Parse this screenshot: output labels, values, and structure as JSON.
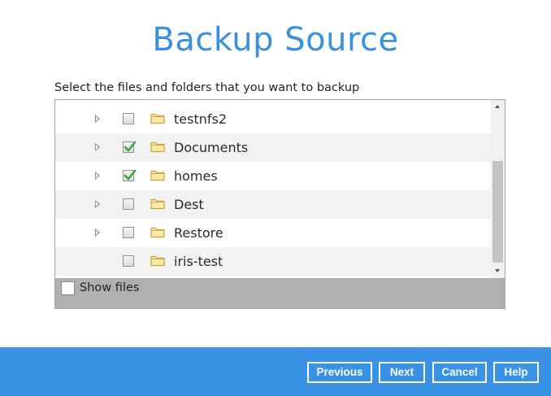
{
  "page": {
    "title": "Backup Source",
    "instruction": "Select the files and folders that you want to backup"
  },
  "tree": {
    "items": [
      {
        "label": "testnfs2",
        "checked": false,
        "expandable": true
      },
      {
        "label": "Documents",
        "checked": true,
        "expandable": true
      },
      {
        "label": "homes",
        "checked": true,
        "expandable": true
      },
      {
        "label": "Dest",
        "checked": false,
        "expandable": true
      },
      {
        "label": "Restore",
        "checked": false,
        "expandable": true
      },
      {
        "label": "iris-test",
        "checked": false,
        "expandable": false
      }
    ]
  },
  "options": {
    "show_files_label": "Show files",
    "show_files_checked": false
  },
  "buttons": {
    "previous": "Previous",
    "next": "Next",
    "cancel": "Cancel",
    "help": "Help"
  },
  "colors": {
    "accent": "#3a8fe0",
    "bottom_bar": "#3a92e6",
    "check_green": "#3aa63a",
    "folder_fill": "#fbe9a6",
    "folder_stroke": "#c9a33a"
  },
  "icons": {
    "expander": "triangle-right-icon",
    "folder": "folder-icon",
    "check": "checkmark-icon"
  }
}
